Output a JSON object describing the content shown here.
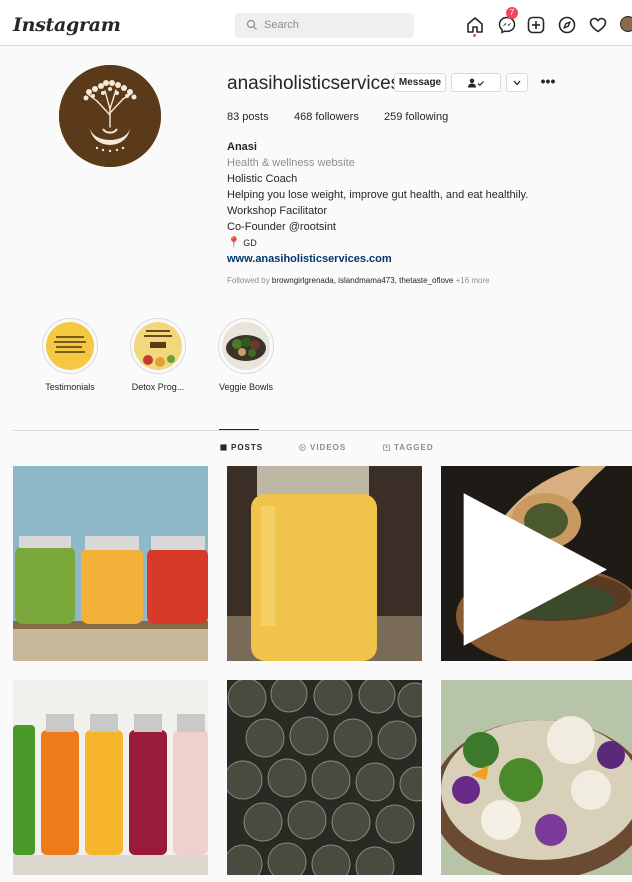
{
  "nav": {
    "logo": "Instagram",
    "search_placeholder": "Search",
    "messages_badge": "7"
  },
  "profile": {
    "username": "anasiholisticservices",
    "message_button": "Message",
    "stats": {
      "posts": "83 posts",
      "followers": "468 followers",
      "following": "259 following"
    },
    "bio": {
      "name": "Anasi",
      "category": "Health & wellness website",
      "lines": [
        "Holistic Coach",
        "Helping you lose weight, improve gut health, and eat healthily.",
        "Workshop Facilitator",
        "Co-Founder @rootsint"
      ],
      "location": "GD",
      "website": "www.anasiholisticservices.com"
    },
    "followed_by_prefix": "Followed by ",
    "followed_by_names": "browngirlgrenada, islandmama473, thetaste_oflove",
    "followed_by_more": " +16 more"
  },
  "highlights": [
    {
      "label": "Testimonials"
    },
    {
      "label": "Detox Prog..."
    },
    {
      "label": "Veggie Bowls"
    }
  ],
  "tabs": {
    "posts": "POSTS",
    "videos": "VIDEOS",
    "tagged": "TAGGED"
  },
  "colors": {
    "badge": "#ed4956",
    "link": "#00376b",
    "brand_brown": "#5b3a1a"
  }
}
